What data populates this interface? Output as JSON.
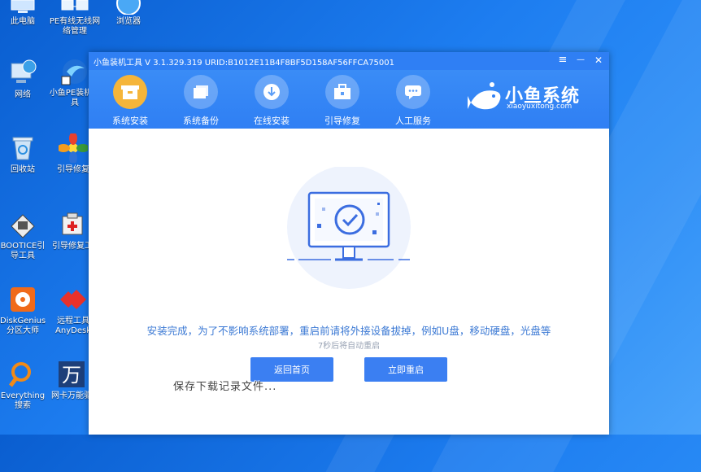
{
  "desktop": {
    "icons": [
      {
        "label": "此电脑",
        "icon": "computer-icon"
      },
      {
        "label": "PE有线无线网络管理",
        "icon": "network-manager-icon"
      },
      {
        "label": "浏览器",
        "icon": "browser-icon"
      },
      {
        "label": "网络",
        "icon": "network-icon"
      },
      {
        "label": "小鱼PE装机工具",
        "icon": "xiaoyu-pe-icon"
      },
      {
        "label": "回收站",
        "icon": "recycle-bin-icon"
      },
      {
        "label": "引导修复",
        "icon": "boot-repair-icon"
      },
      {
        "label": "BOOTICE引导工具",
        "icon": "bootice-icon"
      },
      {
        "label": "引导修复工",
        "icon": "boot-repair-tool-icon"
      },
      {
        "label": "DiskGenius分区大师",
        "icon": "diskgenius-icon"
      },
      {
        "label": "远程工具AnyDesk",
        "icon": "anydesk-icon"
      },
      {
        "label": "Everything搜索",
        "icon": "everything-search-icon"
      },
      {
        "label": "网卡万能驱",
        "icon": "nic-driver-icon"
      }
    ]
  },
  "window": {
    "title": "小鱼装机工具 V 3.1.329.319 URID:B1012E11B4F8BF5D158AF56FFCA75001",
    "controls": {
      "menu": "≡",
      "minimize": "—",
      "close": "✕"
    }
  },
  "toolbar": {
    "items": [
      {
        "label": "系统安装",
        "icon": "system-install-icon",
        "active": true
      },
      {
        "label": "系统备份",
        "icon": "system-backup-icon",
        "active": false
      },
      {
        "label": "在线安装",
        "icon": "online-install-icon",
        "active": false
      },
      {
        "label": "引导修复",
        "icon": "boot-repair-icon",
        "active": false
      },
      {
        "label": "人工服务",
        "icon": "customer-service-icon",
        "active": false
      }
    ],
    "brand_name": "小鱼系统",
    "brand_url": "xiaoyuxitong.com"
  },
  "main": {
    "message": "安装完成，为了不影响系统部署，重启前请将外接设备拔掉，例如U盘，移动硬盘，光盘等",
    "countdown": "7秒后将自动重启",
    "back_button": "返回首页",
    "restart_button": "立即重启"
  },
  "overlay_text": "保存下载记录文件...",
  "colors": {
    "primary": "#2f7ff4",
    "accent": "#f5b53a",
    "message": "#3b79d4"
  }
}
